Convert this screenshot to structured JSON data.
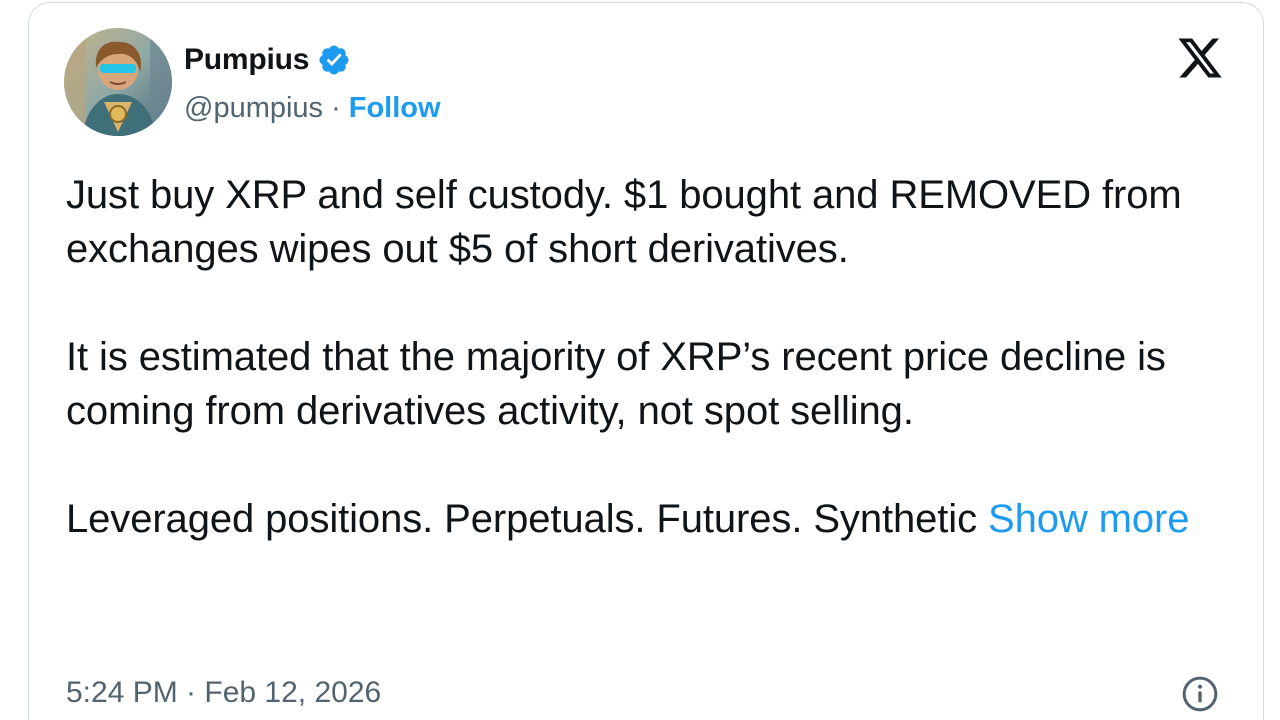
{
  "author": {
    "display_name": "Pumpius",
    "handle": "@pumpius",
    "separator": "·",
    "follow_label": "Follow",
    "verified": true
  },
  "tweet": {
    "paragraphs": [
      "Just buy XRP and self custody. $1 bought and REMOVED from exchanges wipes out $5 of short derivatives.",
      "It is estimated that the majority of XRP’s recent price decline is coming from derivatives activity, not spot selling."
    ],
    "last_paragraph_text": "Leveraged positions. Perpetuals. Futures. Synthetic",
    "show_more_label": "Show more"
  },
  "footer": {
    "timestamp": "5:24 PM · Feb 12, 2026"
  },
  "icons": {
    "verified": "verified-badge-icon",
    "platform_logo": "x-logo-icon",
    "info": "info-icon"
  },
  "colors": {
    "accent": "#1d9bf0",
    "text_primary": "#0f1419",
    "text_secondary": "#536471",
    "border": "#cfd9de"
  }
}
